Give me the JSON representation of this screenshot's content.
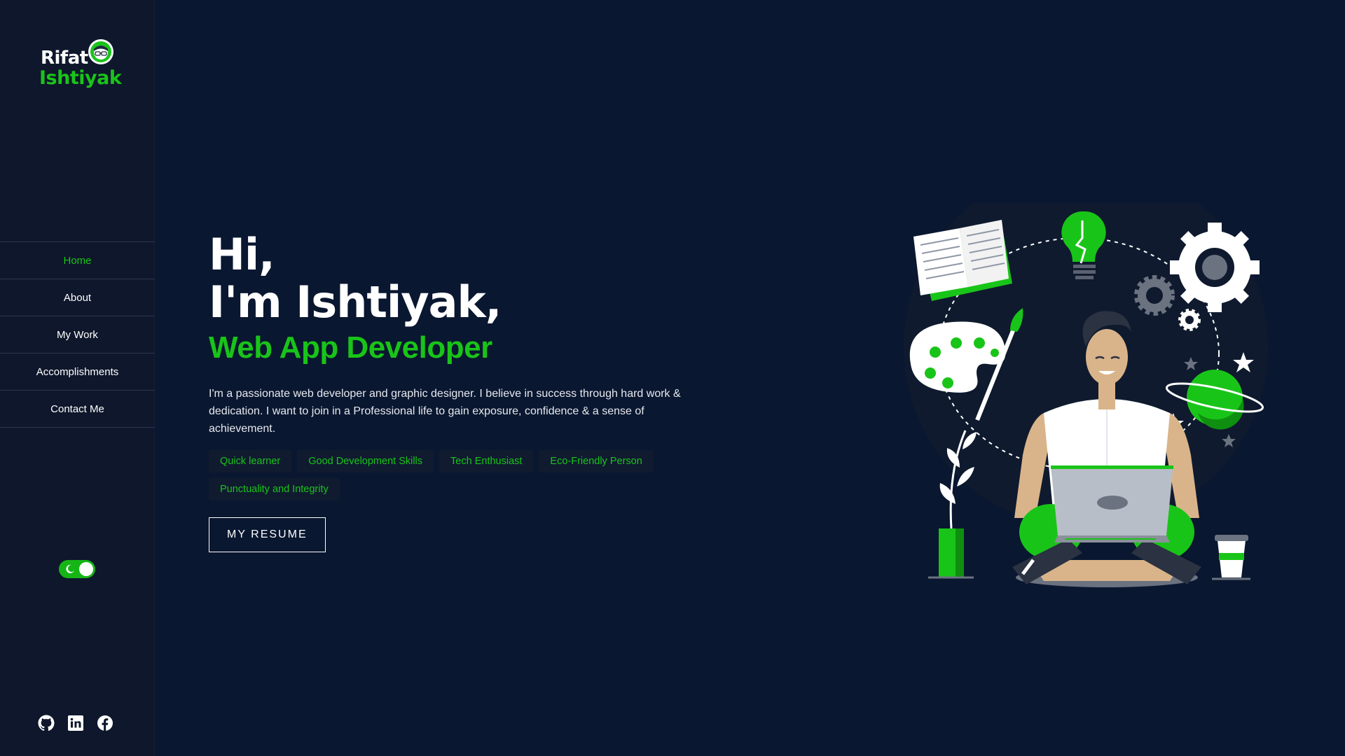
{
  "brand": {
    "first_name": "Rifat",
    "last_name": "Ishtiyak"
  },
  "nav": {
    "items": [
      {
        "label": "Home",
        "active": true
      },
      {
        "label": "About",
        "active": false
      },
      {
        "label": "My Work",
        "active": false
      },
      {
        "label": "Accomplishments",
        "active": false
      },
      {
        "label": "Contact Me",
        "active": false
      }
    ]
  },
  "theme_toggle": {
    "state": "dark",
    "on": true,
    "icon": "moon-icon"
  },
  "socials": [
    {
      "icon": "github-icon"
    },
    {
      "icon": "linkedin-icon"
    },
    {
      "icon": "facebook-icon"
    }
  ],
  "hero": {
    "greeting_line1": "Hi,",
    "greeting_line2": "I'm Ishtiyak,",
    "role": "Web App Developer",
    "intro": "I'm a passionate web developer and graphic designer. I believe in success through hard work & dedication. I want to join in a Professional life to gain exposure, confidence & a sense of achievement.",
    "tags": [
      "Quick learner",
      "Good Development Skills",
      "Tech Enthusiast",
      "Eco-Friendly Person",
      "Punctuality and Integrity"
    ],
    "resume_button": "MY RESUME"
  },
  "colors": {
    "background": "#0a1730",
    "sidebar": "#0e172b",
    "accent": "#19c419",
    "text": "#ffffff"
  }
}
